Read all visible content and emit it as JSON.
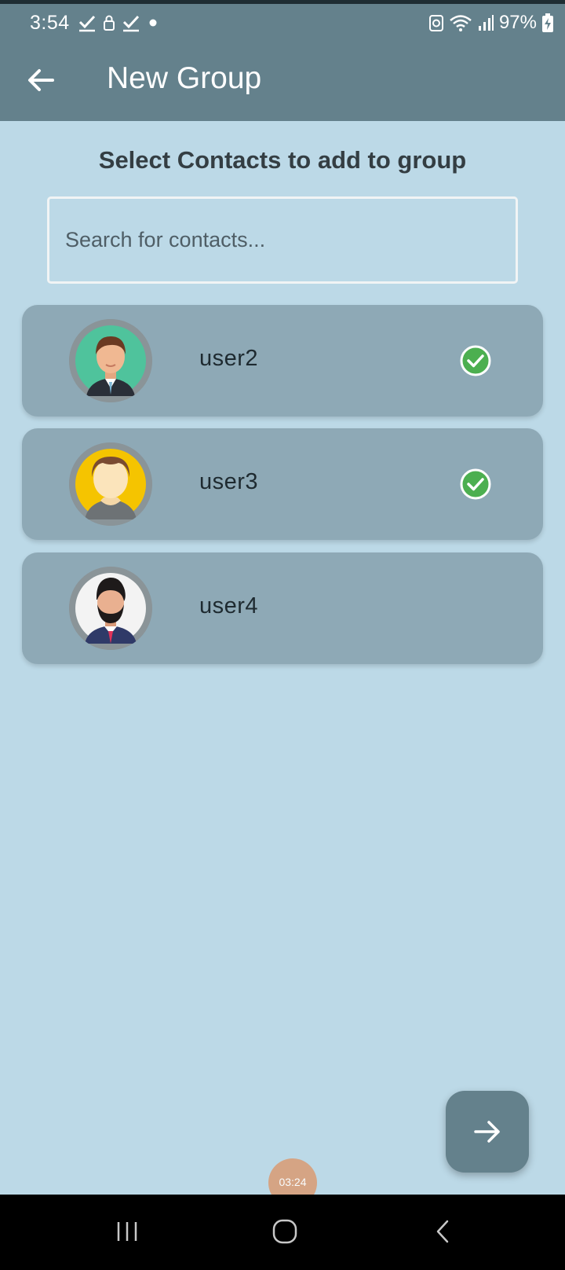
{
  "status_bar": {
    "time": "3:54",
    "battery": "97%",
    "icons_left": [
      "check-icon",
      "lock-icon",
      "check-icon",
      "dot-icon"
    ],
    "icons_right": [
      "recycle-icon",
      "wifi-icon",
      "signal-icon",
      "battery-charging-icon"
    ]
  },
  "header": {
    "title": "New Group",
    "back_icon": "arrow-left-icon",
    "background": "#64818c"
  },
  "main": {
    "heading": "Select Contacts to add to group",
    "search": {
      "placeholder": "Search for contacts...",
      "value": ""
    },
    "contacts": [
      {
        "name": "user2",
        "selected": true,
        "avatar": "avatar-man-green"
      },
      {
        "name": "user3",
        "selected": true,
        "avatar": "avatar-man-yellow"
      },
      {
        "name": "user4",
        "selected": false,
        "avatar": "avatar-man-bearded"
      }
    ]
  },
  "fab": {
    "icon": "arrow-right-icon"
  },
  "timer": {
    "text": "03:24"
  },
  "nav_bar": {
    "buttons": [
      "recents-icon",
      "home-icon",
      "back-icon"
    ]
  },
  "colors": {
    "background": "#bcd9e7",
    "card": "#8ea9b6",
    "check": "#4caf50",
    "fab": "#64818c"
  }
}
